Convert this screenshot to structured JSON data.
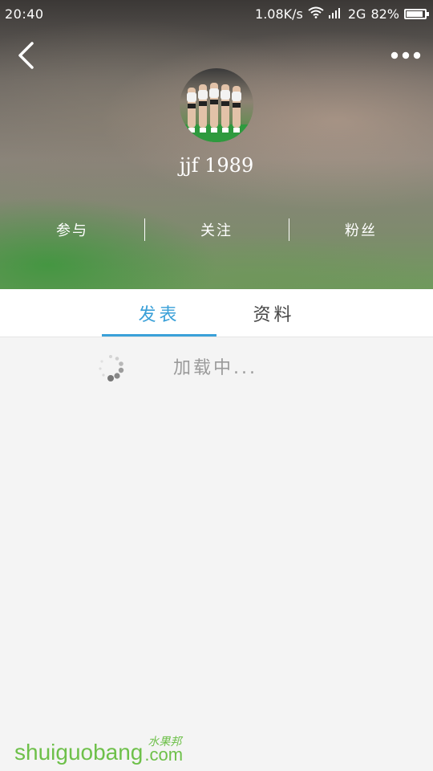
{
  "status_bar": {
    "time": "20:40",
    "speed": "1.08K/s",
    "network": "2G",
    "battery": "82%"
  },
  "profile": {
    "username": "jjf 1989"
  },
  "stats": {
    "participate": "参与",
    "following": "关注",
    "followers": "粉丝"
  },
  "tabs": {
    "posts": "发表",
    "profile": "资料",
    "active": "posts"
  },
  "loading": {
    "text": "加载中..."
  },
  "watermark": {
    "main": "shuiguobang",
    "cn": "水果邦",
    "com": ".com"
  },
  "colors": {
    "accent": "#3aa0d8",
    "watermark": "#6ec04a",
    "background": "#f4f4f4"
  },
  "icons": {
    "back": "chevron-left-icon",
    "more": "more-dots-icon",
    "wifi": "wifi-icon",
    "signal": "signal-icon",
    "battery": "battery-icon",
    "spinner": "loading-spinner-icon"
  }
}
